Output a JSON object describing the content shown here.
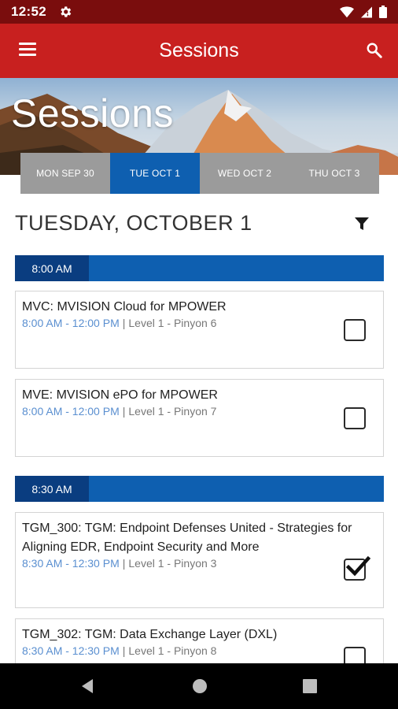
{
  "status_bar": {
    "time": "12:52",
    "icons": [
      "gear-icon",
      "wifi-icon",
      "signal-icon",
      "battery-icon"
    ]
  },
  "app_bar": {
    "title": "Sessions",
    "menu_icon": "menu-icon",
    "search_icon": "search-icon",
    "color": "#c8201f"
  },
  "hero": {
    "title": "Sessions"
  },
  "day_tabs": [
    {
      "label": "MON SEP 30",
      "active": false
    },
    {
      "label": "TUE OCT 1",
      "active": true
    },
    {
      "label": "WED OCT 2",
      "active": false
    },
    {
      "label": "THU OCT 3",
      "active": false
    }
  ],
  "day_heading": "TUESDAY, OCTOBER 1",
  "filter_icon": "filter-icon",
  "groups": [
    {
      "time": "8:00 AM",
      "sessions": [
        {
          "title": "MVC: MVISION Cloud  for MPOWER",
          "time": "8:00 AM - 12:00 PM",
          "location": "Level 1 - Pinyon 6",
          "checked": false
        },
        {
          "title": "MVE: MVISION ePO for MPOWER",
          "time": "8:00 AM - 12:00 PM",
          "location": "Level 1 - Pinyon 7",
          "checked": false
        }
      ]
    },
    {
      "time": "8:30 AM",
      "sessions": [
        {
          "title": "TGM_300: TGM: Endpoint Defenses United - Strategies for Aligning EDR, Endpoint Security and More",
          "time": "8:30 AM - 12:30 PM",
          "location": "Level 1 - Pinyon 3",
          "checked": true
        },
        {
          "title": "TGM_302: TGM: Data Exchange Layer (DXL)",
          "time": "8:30 AM - 12:30 PM",
          "location": "Level 1 - Pinyon 8",
          "checked": false
        }
      ]
    }
  ],
  "nav_bar": {
    "icons": [
      "back-icon",
      "home-icon",
      "recents-icon"
    ]
  },
  "colors": {
    "status_bar": "#7a0d0d",
    "accent_blue": "#0e5fb0",
    "time_label_blue": "#0a3d80",
    "tab_inactive": "#9b9b9b",
    "time_text": "#5a8fd0"
  }
}
